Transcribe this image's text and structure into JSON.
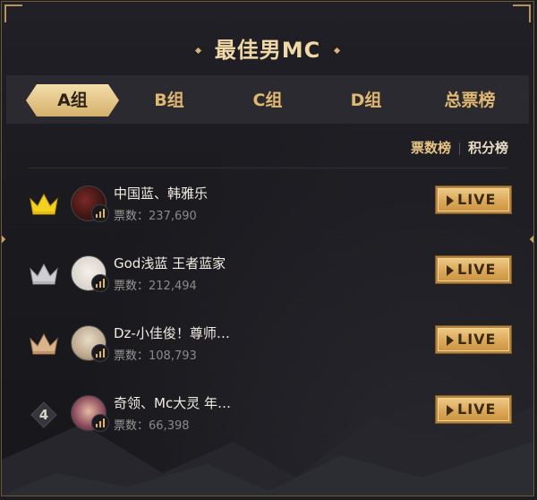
{
  "title": "最佳男MC",
  "tabs": [
    {
      "label": "A组",
      "active": true
    },
    {
      "label": "B组",
      "active": false
    },
    {
      "label": "C组",
      "active": false
    },
    {
      "label": "D组",
      "active": false
    },
    {
      "label": "总票榜",
      "active": false
    }
  ],
  "subtabs": [
    {
      "label": "票数榜",
      "active": true
    },
    {
      "label": "积分榜",
      "active": false
    }
  ],
  "vote_label": "票数：",
  "live_label": "LIVE",
  "entries": [
    {
      "rank": "1",
      "rank_icon": "gold-crown-icon",
      "name": "中国蓝、韩雅乐",
      "votes": "237,690"
    },
    {
      "rank": "2",
      "rank_icon": "silver-crown-icon",
      "name": "God浅蓝 王者蓝家",
      "votes": "212,494"
    },
    {
      "rank": "3",
      "rank_icon": "bronze-crown-icon",
      "name": "Dz-小佳俊！尊师…",
      "votes": "108,793"
    },
    {
      "rank": "4",
      "rank_icon": "rank-diamond-icon",
      "name": "奇领、Mc大灵 年…",
      "votes": "66,398"
    }
  ],
  "colors": {
    "gold": "#e8c586",
    "live_button": "#dba859",
    "background": "#1c1c21"
  }
}
